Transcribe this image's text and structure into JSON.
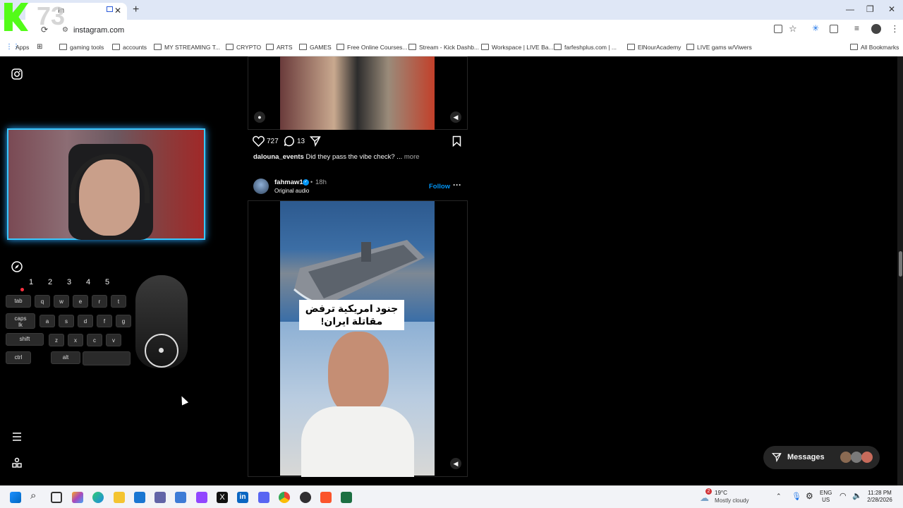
{
  "browser": {
    "tab_title": "In",
    "url": "instagram.com",
    "bookmarks": [
      "Apps",
      "gaming tools",
      "accounts",
      "MY STREAMING T...",
      "CRYPTO",
      "ARTS",
      "GAMES",
      "Free Online Courses...",
      "Stream - Kick Dashb...",
      "Workspace | LIVE Ba...",
      "farfeshplus.com | ...",
      "ElNourAcademy",
      "LIVE gams w/Viwers"
    ],
    "all_bookmarks": "All Bookmarks"
  },
  "overlay": {
    "logo_text": "73",
    "num_keys": [
      "1",
      "2",
      "3",
      "4",
      "5"
    ],
    "row1": [
      "tab",
      "q",
      "w",
      "e",
      "r",
      "t"
    ],
    "row2": [
      "caps lk",
      "a",
      "s",
      "d",
      "f",
      "g"
    ],
    "row3": [
      "shift",
      "z",
      "x",
      "c",
      "v"
    ],
    "row4": [
      "ctrl",
      "alt"
    ]
  },
  "post1": {
    "likes": "727",
    "comments": "13",
    "author": "dalouna_events",
    "caption": "Did they pass the vibe check? ...",
    "more": "more"
  },
  "post2": {
    "author": "fahmaw1",
    "time": "18h",
    "audio": "Original audio",
    "follow": "Follow",
    "overlay_text_line1": "جنود امريكية ترفض",
    "overlay_text_line2": "مقاتلة ايران!"
  },
  "messages": {
    "label": "Messages"
  },
  "taskbar": {
    "weather_badge": "2",
    "temperature": "19°C",
    "weather": "Mostly cloudy",
    "lang1": "ENG",
    "lang2": "US",
    "time": "11:28 PM",
    "date": "2/28/2026"
  },
  "colors": {
    "accent": "#0095f6",
    "webcam_glow": "#39c8ff"
  }
}
